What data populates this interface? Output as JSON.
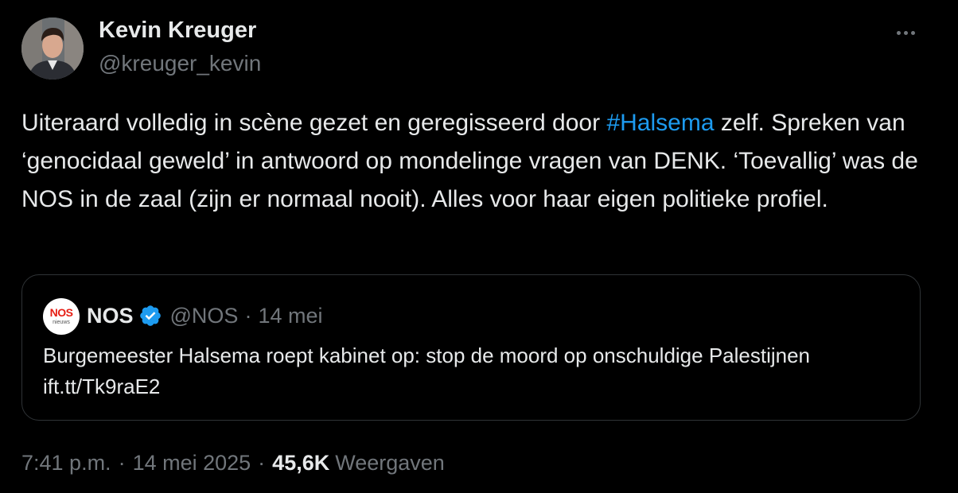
{
  "author": {
    "name": "Kevin Kreuger",
    "handle": "@kreuger_kevin"
  },
  "tweet": {
    "text_before": "Uiteraard volledig in scène gezet en geregisseerd door ",
    "hashtag": "#Halsema",
    "text_after": " zelf. Spreken van ‘genocidaal geweld’ in antwoord op mondelinge vragen van DENK. ‘Toevallig’ was de NOS in de zaal (zijn er normaal nooit). Alles voor haar eigen politieke profiel."
  },
  "quote": {
    "avatar_logo": "NOS",
    "avatar_sub": "nieuws",
    "name": "NOS",
    "handle": "@NOS",
    "separator": "·",
    "date": "14 mei",
    "text": "Burgemeester Halsema roept kabinet op: stop de moord op onschuldige Palestijnen ift.tt/Tk9raE2"
  },
  "meta": {
    "time": "7:41 p.m.",
    "separator": "·",
    "date": "14 mei 2025",
    "views_count": "45,6K",
    "views_label": "Weergaven"
  },
  "icons": {
    "more": "more-horizontal-icon",
    "verified": "verified-badge-icon"
  },
  "colors": {
    "background": "#000000",
    "text": "#e7e9ea",
    "secondary": "#71767b",
    "accent": "#1d9bf0",
    "border": "#2f3336",
    "nos_red": "#e61e14"
  }
}
